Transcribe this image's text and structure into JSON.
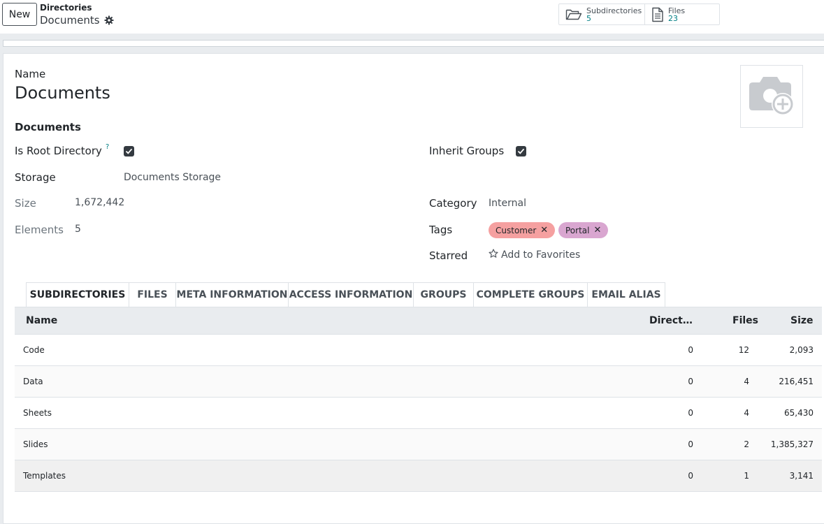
{
  "control_panel": {
    "new_button": "New",
    "breadcrumb_parent": "Directories",
    "breadcrumb_current": "Documents",
    "smart_buttons": [
      {
        "label": "Subdirectories",
        "value": "5",
        "icon": "folder-open-icon"
      },
      {
        "label": "Files",
        "value": "23",
        "icon": "file-text-icon"
      }
    ]
  },
  "form": {
    "name_label": "Name",
    "name_value": "Documents",
    "group_title": "Documents",
    "fields": {
      "is_root_label": "Is Root Directory",
      "is_root_help": "?",
      "is_root_checked": true,
      "storage_label": "Storage",
      "storage_value": "Documents Storage",
      "size_label": "Size",
      "size_value": "1,672,442",
      "elements_label": "Elements",
      "elements_value": "5",
      "inherit_groups_label": "Inherit Groups",
      "inherit_groups_checked": true,
      "category_label": "Category",
      "category_value": "Internal",
      "tags_label": "Tags",
      "tags": [
        {
          "label": "Customer",
          "color": "#f5a0a0"
        },
        {
          "label": "Portal",
          "color": "#d9a6d0"
        }
      ],
      "starred_label": "Starred",
      "starred_value": "Add to Favorites"
    }
  },
  "tabs": [
    {
      "label": "SUBDIRECTORIES",
      "active": true
    },
    {
      "label": "FILES",
      "active": false
    },
    {
      "label": "META INFORMATION",
      "active": false
    },
    {
      "label": "ACCESS INFORMATION",
      "active": false
    },
    {
      "label": "GROUPS",
      "active": false
    },
    {
      "label": "COMPLETE GROUPS",
      "active": false
    },
    {
      "label": "EMAIL ALIAS",
      "active": false
    }
  ],
  "table": {
    "headers": {
      "name": "Name",
      "directories": "Directori…",
      "files": "Files",
      "size": "Size"
    },
    "rows": [
      {
        "name": "Code",
        "directories": "0",
        "files": "12",
        "size": "2,093"
      },
      {
        "name": "Data",
        "directories": "0",
        "files": "4",
        "size": "216,451"
      },
      {
        "name": "Sheets",
        "directories": "0",
        "files": "4",
        "size": "65,430"
      },
      {
        "name": "Slides",
        "directories": "0",
        "files": "2",
        "size": "1,385,327"
      },
      {
        "name": "Templates",
        "directories": "0",
        "files": "1",
        "size": "3,141"
      }
    ]
  },
  "colors": {
    "accent": "#017e84",
    "tag_customer": "#f5a0a0",
    "tag_portal": "#d9a6d0",
    "checkbox": "#343a40"
  }
}
